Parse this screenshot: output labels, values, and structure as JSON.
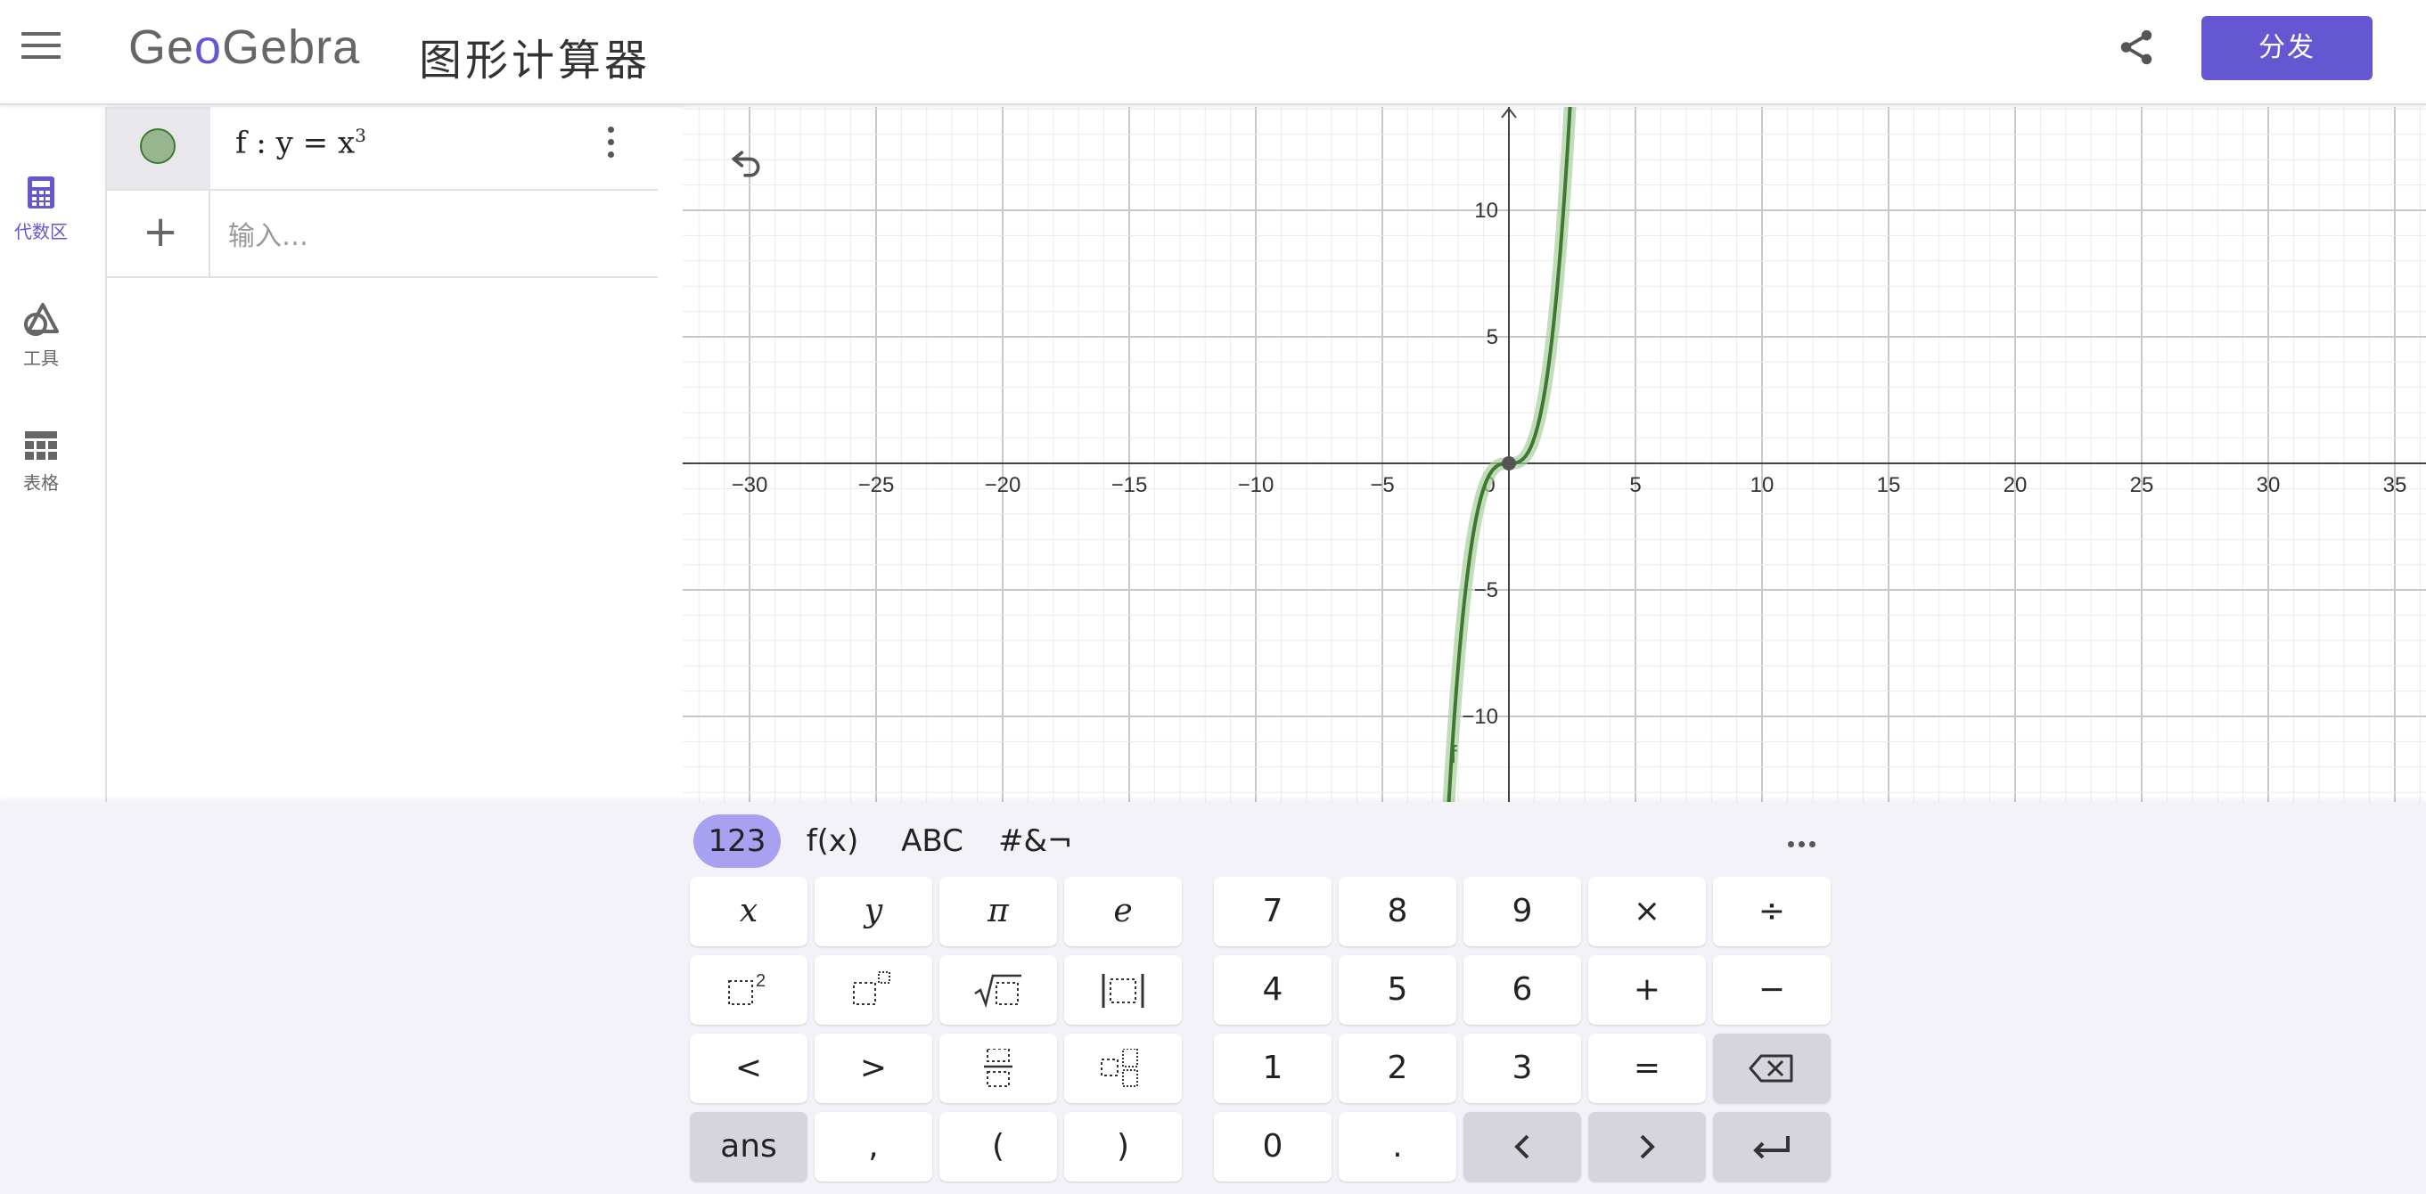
{
  "header": {
    "brand_pre": "Ge",
    "brand_o": "o",
    "brand_post": "Gebra",
    "app_title": "图形计算器",
    "share_button": "分发"
  },
  "nav": {
    "items": [
      {
        "label": "代数区",
        "icon": "calculator-icon",
        "active": true
      },
      {
        "label": "工具",
        "icon": "shapes-icon",
        "active": false
      },
      {
        "label": "表格",
        "icon": "table-icon",
        "active": false
      }
    ]
  },
  "algebra": {
    "formula_prefix": "f : y = x",
    "formula_exponent": "3",
    "input_placeholder": "输入…",
    "plus": "+"
  },
  "graph": {
    "function": "y = x^3",
    "function_label": "f",
    "curve_color": "#3d7a30",
    "x_ticks": [
      "−30",
      "−25",
      "−20",
      "−15",
      "−10",
      "−5",
      "0",
      "5",
      "10",
      "15",
      "20",
      "25",
      "30",
      "35"
    ],
    "y_ticks": [
      "10",
      "5",
      "−5",
      "−10"
    ]
  },
  "keyboard": {
    "tabs": [
      "123",
      "f(x)",
      "ABC",
      "#&¬"
    ],
    "active_tab": "123",
    "left_keys": [
      [
        "x",
        "y",
        "π",
        "e"
      ],
      [
        "square",
        "power",
        "sqrt",
        "abs"
      ],
      [
        "<",
        ">",
        "fraction",
        "subscript"
      ],
      [
        "ans",
        ",",
        "(",
        ")"
      ]
    ],
    "right_keys": [
      [
        "7",
        "8",
        "9",
        "×",
        "÷"
      ],
      [
        "4",
        "5",
        "6",
        "+",
        "−"
      ],
      [
        "1",
        "2",
        "3",
        "=",
        "backspace"
      ],
      [
        "0",
        ".",
        "left",
        "right",
        "enter"
      ]
    ],
    "square_sup": "2"
  },
  "colors": {
    "accent": "#6557d2",
    "active_tab": "#a8a0f0",
    "keyboard_bg": "#f3f2f8"
  }
}
